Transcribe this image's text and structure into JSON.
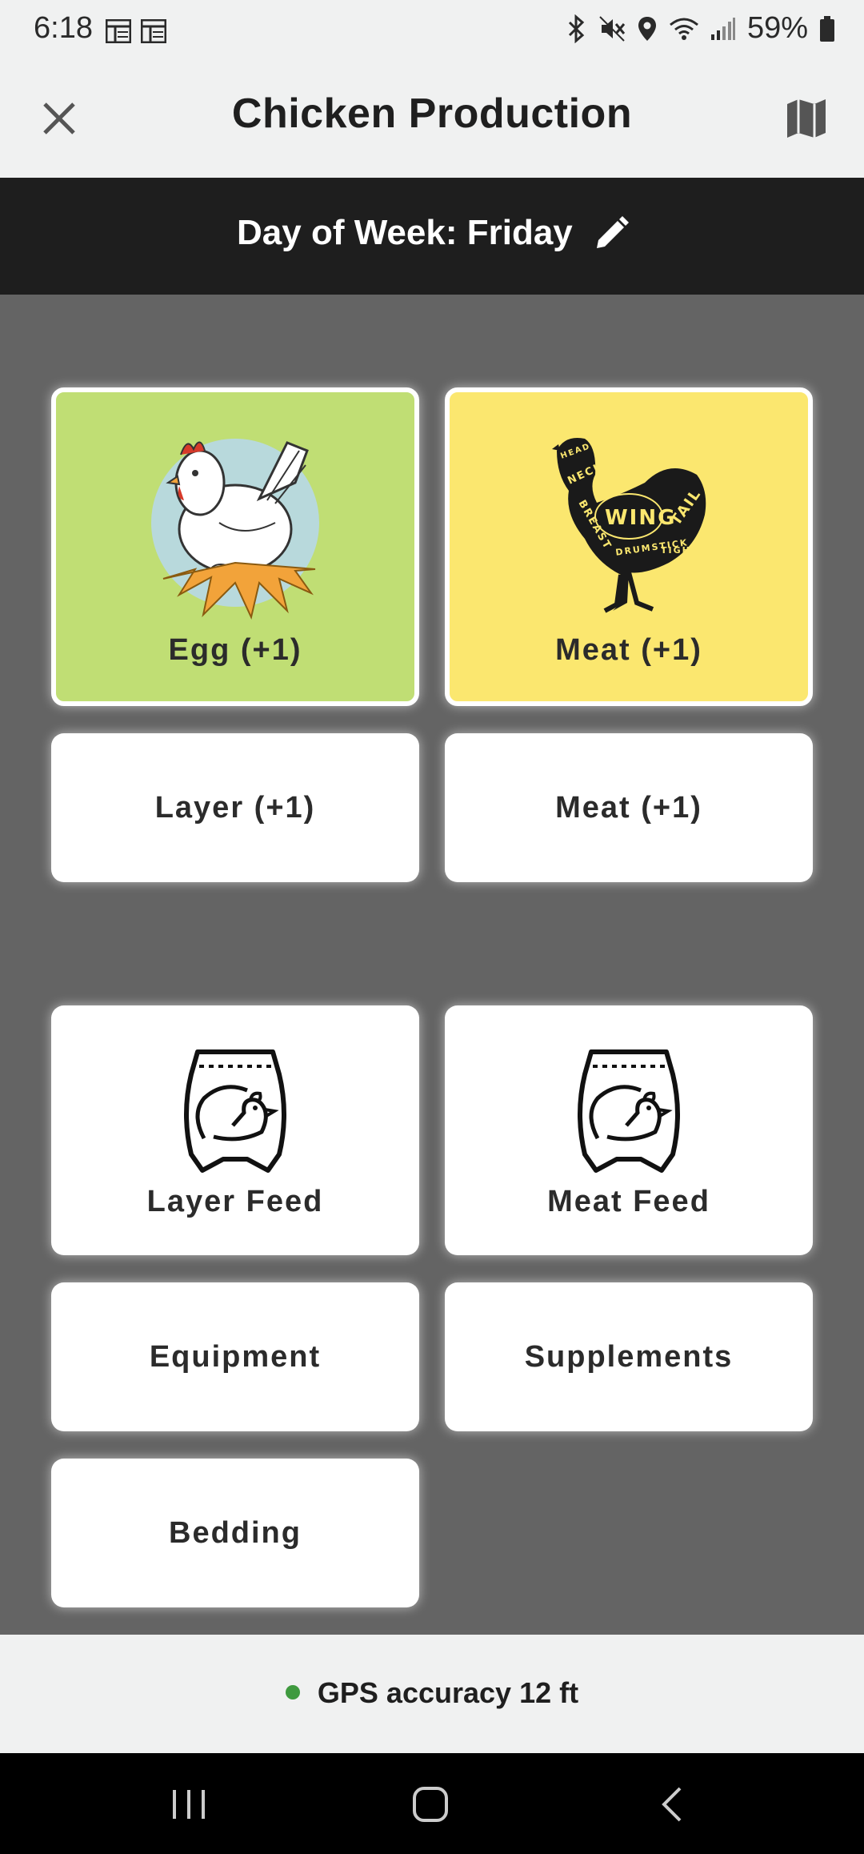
{
  "status_bar": {
    "time": "6:18",
    "battery": "59%",
    "left_icons": [
      "notes-icon",
      "notes-icon"
    ],
    "right_icons": [
      "bluetooth-icon",
      "mute-icon",
      "location-icon",
      "wifi-icon",
      "signal-icon",
      "battery-icon"
    ]
  },
  "header": {
    "title": "Chicken Production"
  },
  "day_bar": {
    "label": "Day of Week: Friday"
  },
  "tiles": {
    "egg": {
      "label": "Egg (+1)",
      "color": "#c0de74"
    },
    "meat_top": {
      "label": "Meat (+1)",
      "color": "#fbe76f"
    },
    "layer": {
      "label": "Layer (+1)"
    },
    "meat_bottom": {
      "label": "Meat (+1)"
    },
    "layer_feed": {
      "label": "Layer Feed"
    },
    "meat_feed": {
      "label": "Meat Feed"
    },
    "equipment": {
      "label": "Equipment"
    },
    "supplements": {
      "label": "Supplements"
    },
    "bedding": {
      "label": "Bedding"
    }
  },
  "meat_diagram": {
    "labels": [
      "HEAD",
      "NECK",
      "WING",
      "TAIL",
      "BREAST",
      "DRUMSTICK",
      "TIGH"
    ]
  },
  "footer": {
    "gps": "GPS accuracy 12 ft",
    "gps_color": "#3f9a3f"
  }
}
